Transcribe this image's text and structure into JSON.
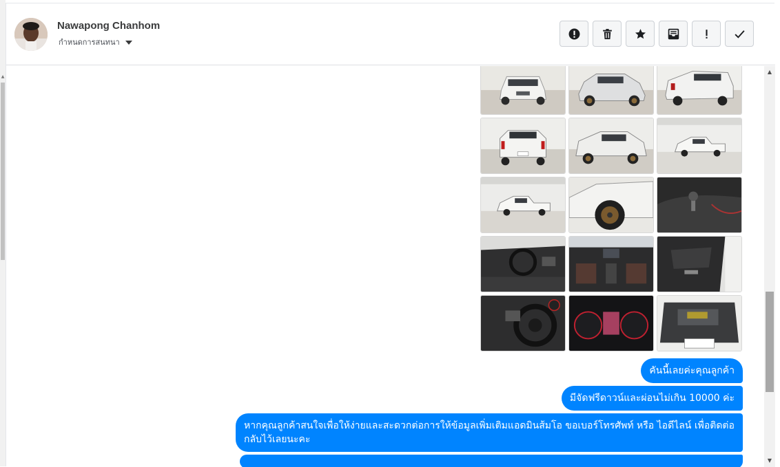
{
  "contact": {
    "name": "Nawapong Chanhom",
    "subtitle": "กำหนดการสนทนา"
  },
  "toolbar": {
    "buttons": [
      {
        "name": "report-icon",
        "glyph": "!"
      },
      {
        "name": "trash-icon",
        "glyph": ""
      },
      {
        "name": "star-icon",
        "glyph": "★"
      },
      {
        "name": "mark-unread-icon",
        "glyph": ""
      },
      {
        "name": "important-icon",
        "glyph": "!"
      },
      {
        "name": "check-icon",
        "glyph": "✓"
      }
    ]
  },
  "photos": [
    {
      "name": "car-front"
    },
    {
      "name": "car-front-three-quarter"
    },
    {
      "name": "car-rear-three-quarter"
    },
    {
      "name": "car-rear"
    },
    {
      "name": "car-rear-side"
    },
    {
      "name": "car-side-far"
    },
    {
      "name": "car-side"
    },
    {
      "name": "car-wheel"
    },
    {
      "name": "gear-shift"
    },
    {
      "name": "dashboard-left"
    },
    {
      "name": "dashboard-center"
    },
    {
      "name": "door-panel"
    },
    {
      "name": "steering-wheel"
    },
    {
      "name": "instrument-cluster"
    },
    {
      "name": "engine-bay"
    }
  ],
  "messages": [
    {
      "text": "คันนี้เลยค่ะคุณลูกค้า"
    },
    {
      "text": "มีจัดฟรีดาวน์และผ่อนไม่เกิน 10000 ค่ะ"
    },
    {
      "text": "หากคุณลูกค้าสนใจเพื่อให้ง่ายและสะดวกต่อการให้ข้อมูลเพิ่มเติมแอดมินส้มโอ ขอเบอร์โทรศัพท์ หรือ ไอดีไลน์ เพื่อติดต่อกลับไว้เลยนะคะ"
    }
  ],
  "colors": {
    "bubble": "#0084ff",
    "header_text": "#3a3b3c"
  }
}
